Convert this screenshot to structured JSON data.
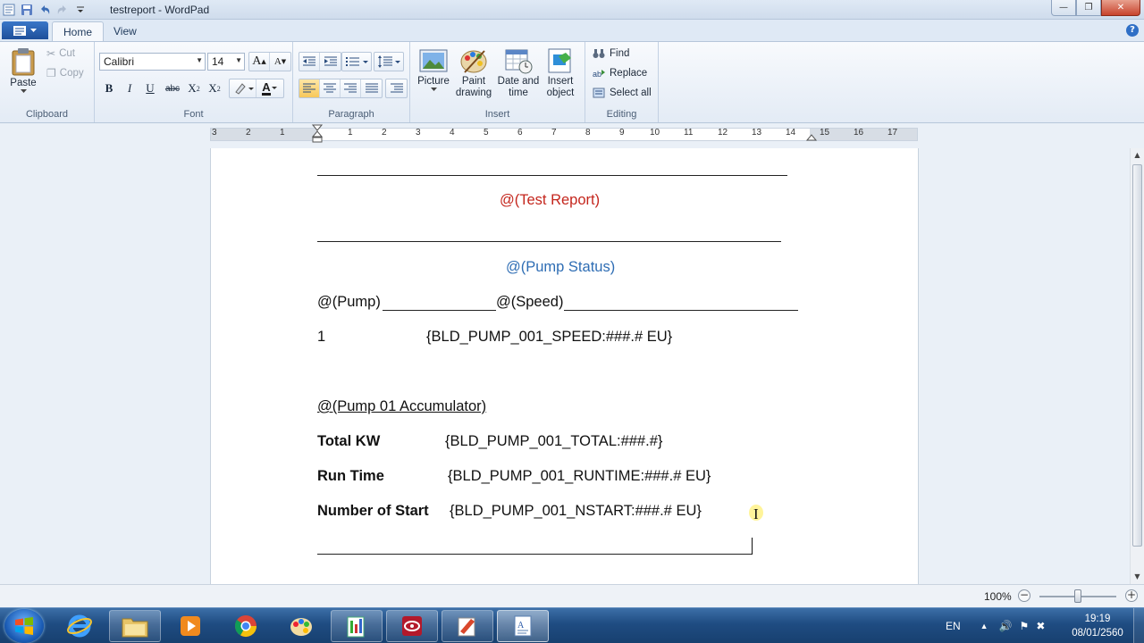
{
  "window": {
    "title": "testreport - WordPad",
    "controls": {
      "minimize": "—",
      "maximize": "❐",
      "close": "✕"
    }
  },
  "ribbon": {
    "tabs": [
      {
        "label": "Home",
        "active": true
      },
      {
        "label": "View",
        "active": false
      }
    ],
    "groups": {
      "clipboard": {
        "label": "Clipboard",
        "paste": "Paste",
        "cut": "Cut",
        "copy": "Copy"
      },
      "font": {
        "label": "Font",
        "family": "Calibri",
        "size": "14",
        "grow": "A",
        "shrink": "A",
        "bold": "B",
        "italic": "I",
        "underline": "U",
        "strike": "abc",
        "subscript": "X",
        "superscript": "X",
        "text_color_letter": "A"
      },
      "paragraph": {
        "label": "Paragraph"
      },
      "insert": {
        "label": "Insert",
        "picture": "Picture",
        "paint": "Paint drawing",
        "datetime": "Date and time",
        "object": "Insert object"
      },
      "editing": {
        "label": "Editing",
        "find": "Find",
        "replace": "Replace",
        "select_all": "Select all"
      }
    }
  },
  "ruler": {
    "ticks": [
      "3",
      "2",
      "1",
      "1",
      "2",
      "3",
      "4",
      "5",
      "6",
      "7",
      "8",
      "9",
      "10",
      "11",
      "12",
      "13",
      "14",
      "15",
      "16",
      "17"
    ]
  },
  "document": {
    "title": "@(Test Report)",
    "section": "@(Pump Status)",
    "col_pump": "@(Pump)",
    "col_speed": "@(Speed)",
    "row1_id": "1",
    "row1_value": "{BLD_PUMP_001_SPEED:###.# EU}",
    "accumulator_heading": "@(Pump 01 Accumulator)",
    "rows": [
      {
        "label": "Total KW",
        "value": "{BLD_PUMP_001_TOTAL:###.#}"
      },
      {
        "label": "Run Time",
        "value": "{BLD_PUMP_001_RUNTIME:###.# EU}"
      },
      {
        "label": "Number of Start",
        "value": "{BLD_PUMP_001_NSTART:###.# EU}"
      }
    ]
  },
  "statusbar": {
    "zoom": "100%",
    "zoom_minus": "−",
    "zoom_plus": "+"
  },
  "taskbar": {
    "language": "EN",
    "time": "19:19",
    "date": "08/01/2560"
  }
}
